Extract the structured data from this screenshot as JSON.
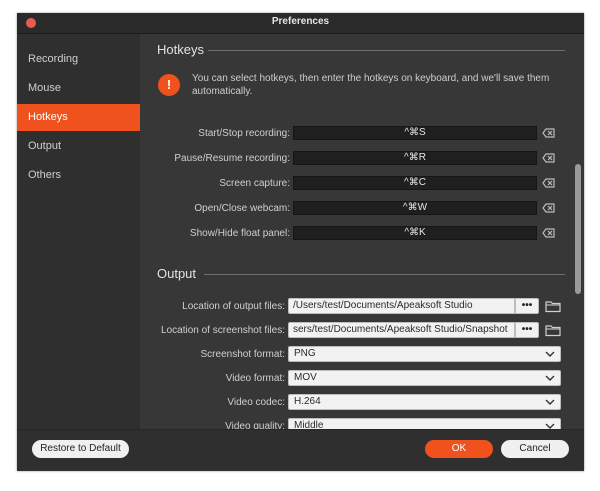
{
  "window": {
    "title": "Preferences"
  },
  "sidebar": {
    "items": [
      {
        "label": "Recording",
        "active": false
      },
      {
        "label": "Mouse",
        "active": false
      },
      {
        "label": "Hotkeys",
        "active": true
      },
      {
        "label": "Output",
        "active": false
      },
      {
        "label": "Others",
        "active": false
      }
    ]
  },
  "hotkeys": {
    "title": "Hotkeys",
    "info": "You can select hotkeys, then enter the hotkeys on keyboard, and we'll save them automatically.",
    "rows": [
      {
        "label": "Start/Stop recording:",
        "value": "^⌘S"
      },
      {
        "label": "Pause/Resume recording:",
        "value": "^⌘R"
      },
      {
        "label": "Screen capture:",
        "value": "^⌘C"
      },
      {
        "label": "Open/Close webcam:",
        "value": "^⌘W"
      },
      {
        "label": "Show/Hide float panel:",
        "value": "^⌘K"
      }
    ]
  },
  "output": {
    "title": "Output",
    "output_files_label": "Location of output files:",
    "output_files_value": "/Users/test/Documents/Apeaksoft Studio",
    "screenshot_files_label": "Location of screenshot files:",
    "screenshot_files_value": "sers/test/Documents/Apeaksoft Studio/Snapshot",
    "browse_label": "•••",
    "screenshot_format_label": "Screenshot format:",
    "screenshot_format_value": "PNG",
    "video_format_label": "Video format:",
    "video_format_value": "MOV",
    "video_codec_label": "Video codec:",
    "video_codec_value": "H.264",
    "video_quality_label": "Video quality:",
    "video_quality_value": "Middle"
  },
  "footer": {
    "restore_label": "Restore to Default",
    "ok_label": "OK",
    "cancel_label": "Cancel"
  },
  "colors": {
    "accent": "#f0521d",
    "background": "#373737",
    "sidebar": "#2f2f2f"
  }
}
